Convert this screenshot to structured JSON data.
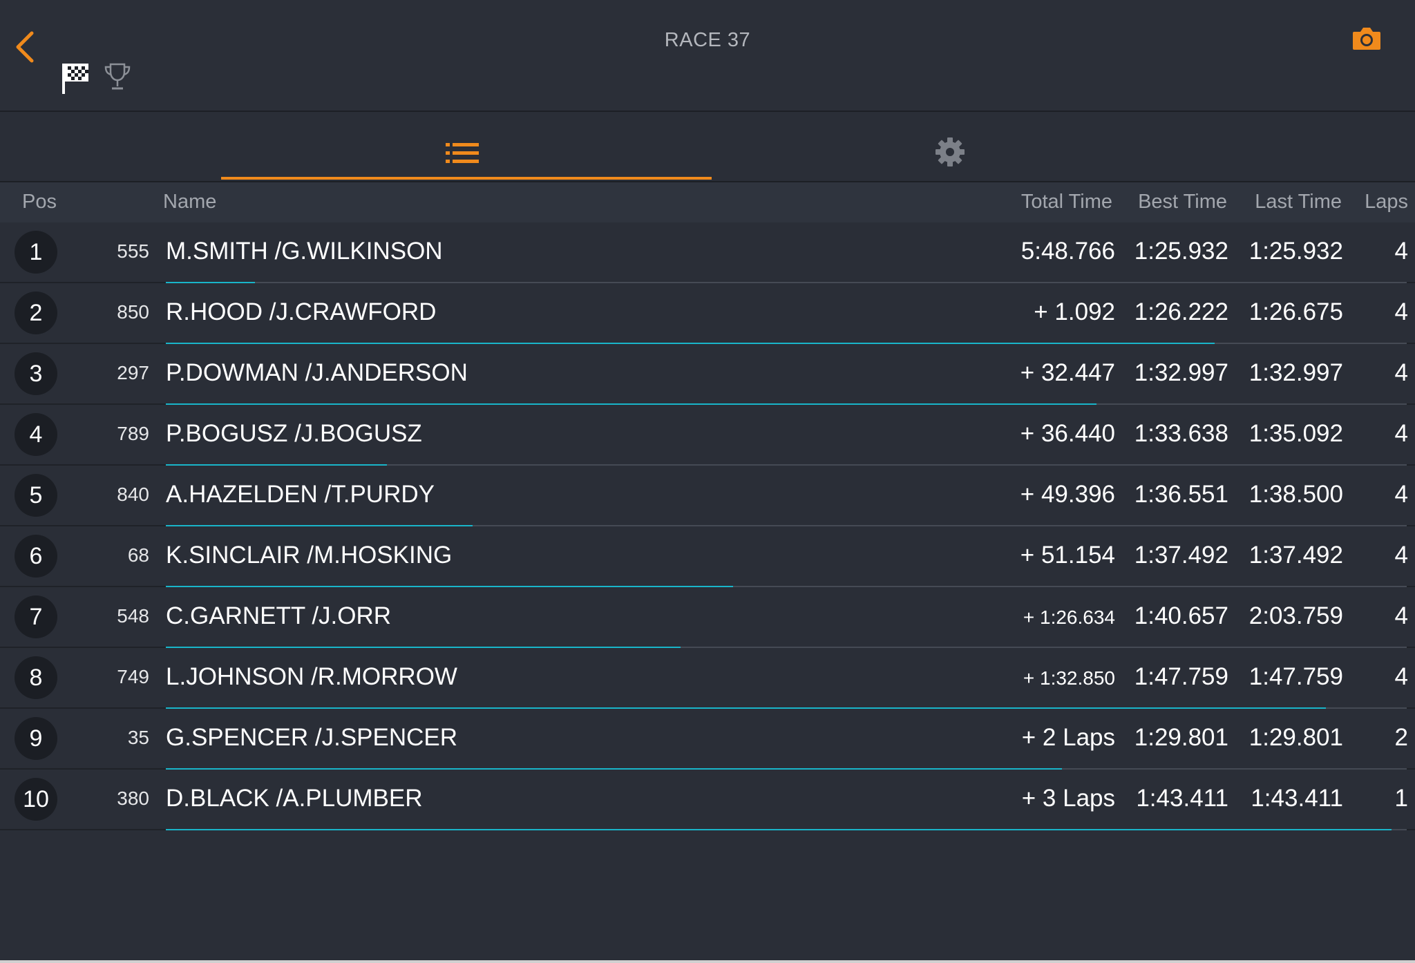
{
  "header": {
    "title": "RACE 37",
    "icons": {
      "back": "chevron-left-icon",
      "flag": "checkered-flag-icon",
      "trophy": "trophy-icon",
      "camera": "camera-icon"
    },
    "accent_color": "#f08a1c"
  },
  "tabs": [
    {
      "name": "list",
      "icon": "list-icon",
      "active": true
    },
    {
      "name": "settings",
      "icon": "gear-icon",
      "active": false
    }
  ],
  "columns": {
    "pos": "Pos",
    "name": "Name",
    "total": "Total Time",
    "best": "Best Time",
    "last": "Last Time",
    "laps": "Laps"
  },
  "progress_color": "#19b5c9",
  "rows": [
    {
      "pos": "1",
      "num": "555",
      "name": "M.SMITH /G.WILKINSON",
      "total": "5:48.766",
      "total_small": false,
      "best": "1:25.932",
      "last": "1:25.932",
      "laps": "4",
      "progress": 0.072
    },
    {
      "pos": "2",
      "num": "850",
      "name": "R.HOOD /J.CRAWFORD",
      "total": "+ 1.092",
      "total_small": false,
      "best": "1:26.222",
      "last": "1:26.675",
      "laps": "4",
      "progress": 0.845
    },
    {
      "pos": "3",
      "num": "297",
      "name": "P.DOWMAN /J.ANDERSON",
      "total": "+ 32.447",
      "total_small": false,
      "best": "1:32.997",
      "last": "1:32.997",
      "laps": "4",
      "progress": 0.75
    },
    {
      "pos": "4",
      "num": "789",
      "name": "P.BOGUSZ /J.BOGUSZ",
      "total": "+ 36.440",
      "total_small": false,
      "best": "1:33.638",
      "last": "1:35.092",
      "laps": "4",
      "progress": 0.178
    },
    {
      "pos": "5",
      "num": "840",
      "name": "A.HAZELDEN /T.PURDY",
      "total": "+ 49.396",
      "total_small": false,
      "best": "1:36.551",
      "last": "1:38.500",
      "laps": "4",
      "progress": 0.247
    },
    {
      "pos": "6",
      "num": "68",
      "name": "K.SINCLAIR /M.HOSKING",
      "total": "+ 51.154",
      "total_small": false,
      "best": "1:37.492",
      "last": "1:37.492",
      "laps": "4",
      "progress": 0.457
    },
    {
      "pos": "7",
      "num": "548",
      "name": "C.GARNETT /J.ORR",
      "total": "+ 1:26.634",
      "total_small": true,
      "best": "1:40.657",
      "last": "2:03.759",
      "laps": "4",
      "progress": 0.415
    },
    {
      "pos": "8",
      "num": "749",
      "name": "L.JOHNSON /R.MORROW",
      "total": "+ 1:32.850",
      "total_small": true,
      "best": "1:47.759",
      "last": "1:47.759",
      "laps": "4",
      "progress": 0.935
    },
    {
      "pos": "9",
      "num": "35",
      "name": "G.SPENCER /J.SPENCER",
      "total": "+ 2 Laps",
      "total_small": false,
      "best": "1:29.801",
      "last": "1:29.801",
      "laps": "2",
      "progress": 0.722
    },
    {
      "pos": "10",
      "num": "380",
      "name": "D.BLACK /A.PLUMBER",
      "total": "+ 3 Laps",
      "total_small": false,
      "best": "1:43.411",
      "last": "1:43.411",
      "laps": "1",
      "progress": 0.988
    }
  ]
}
